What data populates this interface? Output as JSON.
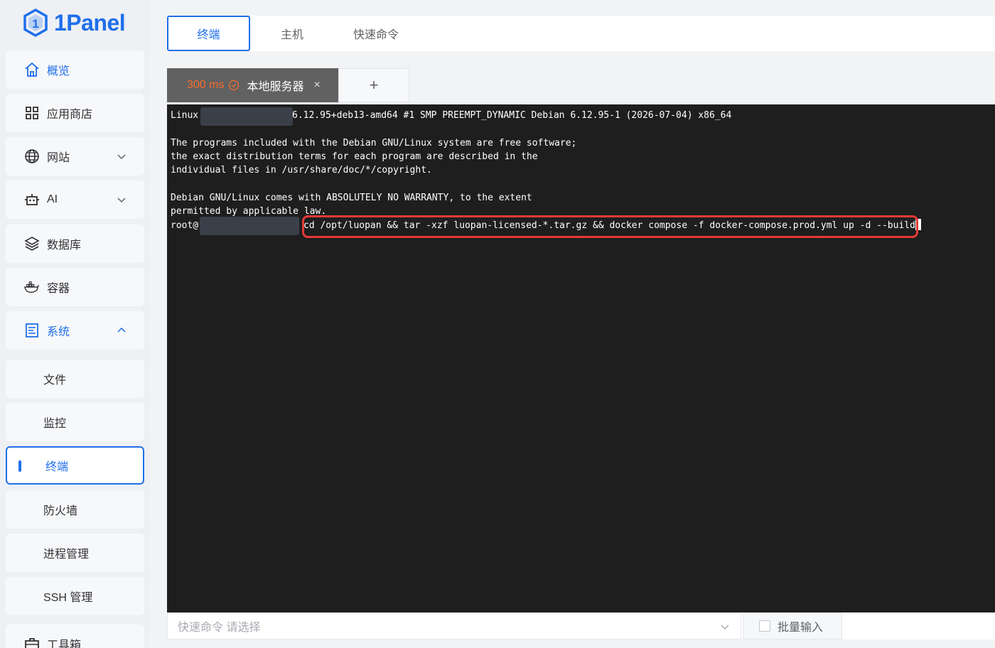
{
  "app": {
    "logo_text": "1Panel",
    "accent": "#1f6feb"
  },
  "sidebar": {
    "items": [
      {
        "label": "概览",
        "icon": "home-icon"
      },
      {
        "label": "应用商店",
        "icon": "grid-icon"
      },
      {
        "label": "网站",
        "icon": "globe-icon"
      },
      {
        "label": "AI",
        "icon": "robot-icon"
      },
      {
        "label": "数据库",
        "icon": "layers-icon"
      },
      {
        "label": "容器",
        "icon": "docker-icon"
      },
      {
        "label": "系统",
        "icon": "server-icon"
      },
      {
        "label": "工具箱",
        "icon": "toolbox-icon"
      }
    ],
    "sub_items": [
      {
        "label": "文件"
      },
      {
        "label": "监控"
      },
      {
        "label": "终端"
      },
      {
        "label": "防火墙"
      },
      {
        "label": "进程管理"
      },
      {
        "label": "SSH 管理"
      }
    ]
  },
  "top_tabs": [
    {
      "label": "终端"
    },
    {
      "label": "主机"
    },
    {
      "label": "快速命令"
    }
  ],
  "terminal_tab": {
    "latency": "300 ms",
    "server": "本地服务器",
    "close": "×",
    "add": "+"
  },
  "terminal": {
    "line1_prefix": "Linux",
    "line1_suffix": "6.12.95+deb13-amd64 #1 SMP PREEMPT_DYNAMIC Debian 6.12.95-1 (2026-07-04) x86_64",
    "line2": "The programs included with the Debian GNU/Linux system are free software;",
    "line3": "the exact distribution terms for each program are described in the",
    "line4": "individual files in /usr/share/doc/*/copyright.",
    "line5": "Debian GNU/Linux comes with ABSOLUTELY NO WARRANTY, to the extent",
    "line6": "permitted by applicable law.",
    "prompt_prefix": "root@",
    "command": "cd /opt/luopan && tar -xzf luopan-licensed-*.tar.gz && docker compose -f docker-compose.prod.yml up -d --build"
  },
  "bottom": {
    "quick_command_placeholder": "快速命令  请选择",
    "batch_input_label": "批量输入"
  }
}
